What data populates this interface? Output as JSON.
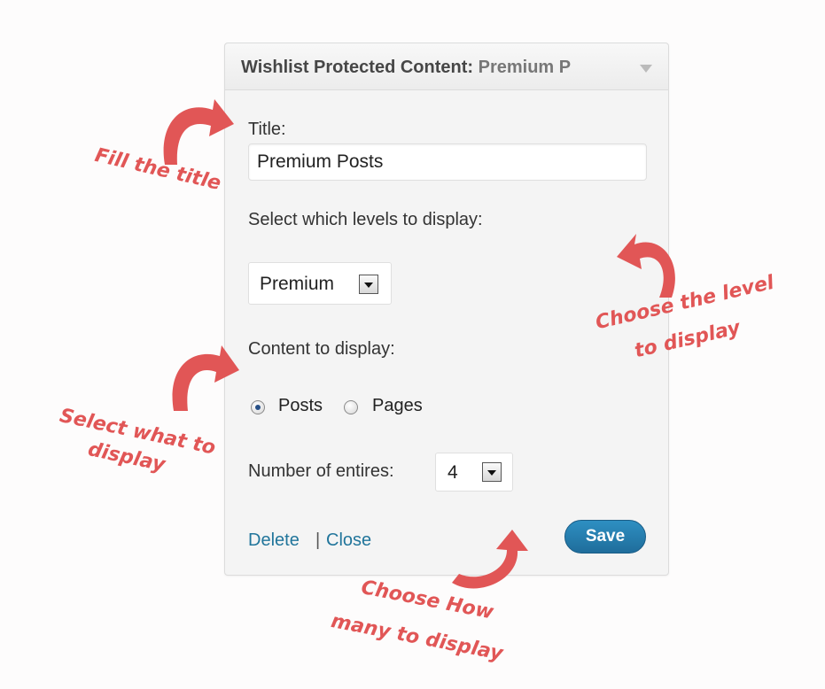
{
  "widget": {
    "title_bold": "Wishlist Protected Content:",
    "title_instance": "Premium P",
    "title_label": "Title:",
    "title_value": "Premium Posts",
    "levels_label": "Select which levels to display:",
    "level_selected": "Premium",
    "content_label": "Content to display:",
    "content_options": [
      {
        "label": "Posts",
        "checked": true
      },
      {
        "label": "Pages",
        "checked": false
      }
    ],
    "entries_label": "Number of entires:",
    "entries_value": "4",
    "delete_label": "Delete",
    "separator": "|",
    "close_label": "Close",
    "save_label": "Save"
  },
  "annotations": {
    "fill_title": "Fill the title",
    "choose_level_line1": "Choose the level",
    "choose_level_line2": "to display",
    "select_what_line1": "Select what to",
    "select_what_line2": "display",
    "choose_how_line1": "Choose How",
    "choose_how_line2": "many to display"
  },
  "colors": {
    "annotation": "#e15656",
    "link": "#21759b",
    "save_button": "#2a81b4"
  }
}
